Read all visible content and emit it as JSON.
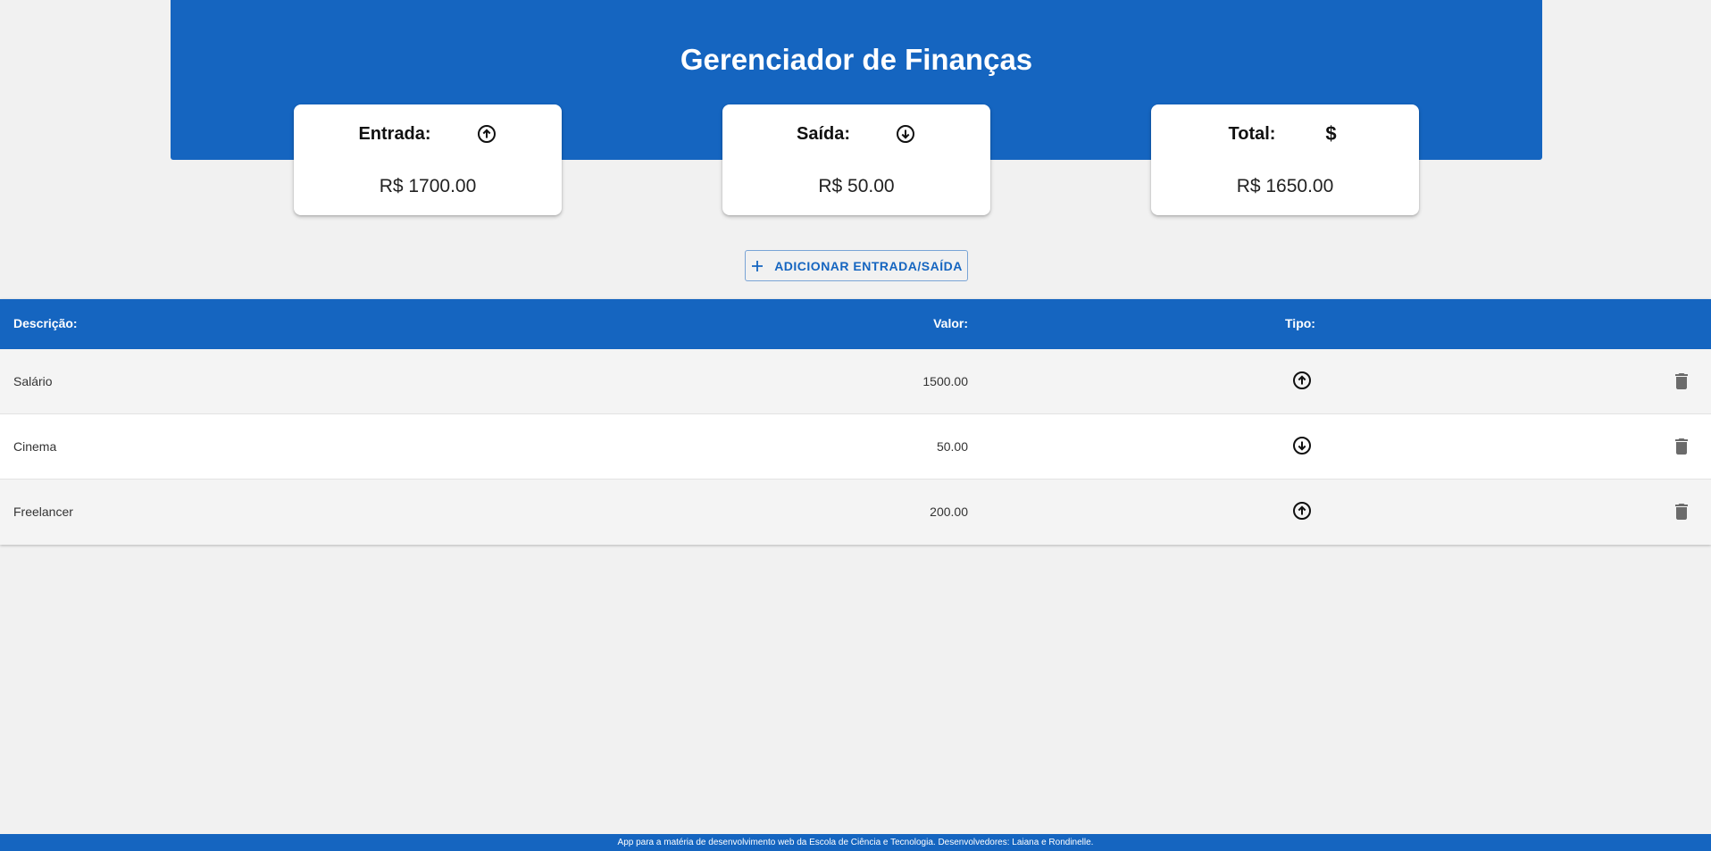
{
  "header": {
    "title": "Gerenciador de Finanças",
    "color": "#1565c0"
  },
  "cards": {
    "entrada": {
      "label": "Entrada:",
      "icon": "arrow-up-circle-icon",
      "value": "R$ 1700.00"
    },
    "saida": {
      "label": "Saída:",
      "icon": "arrow-down-circle-icon",
      "value": "R$ 50.00"
    },
    "total": {
      "label": "Total:",
      "icon": "dollar-icon",
      "symbol": "$",
      "value": "R$ 1650.00"
    }
  },
  "add_button": {
    "label": "ADICIONAR ENTRADA/SAÍDA",
    "icon": "plus-icon"
  },
  "table": {
    "headers": {
      "descricao": "Descrição:",
      "valor": "Valor:",
      "tipo": "Tipo:"
    },
    "rows": [
      {
        "descricao": "Salário",
        "valor": "1500.00",
        "tipo": "entrada"
      },
      {
        "descricao": "Cinema",
        "valor": "50.00",
        "tipo": "saida"
      },
      {
        "descricao": "Freelancer",
        "valor": "200.00",
        "tipo": "entrada"
      }
    ]
  },
  "footer": {
    "text": "App para a matéria de desenvolvimento web da Escola de Ciência e Tecnologia. Desenvolvedores: Laiana e Rondinelle."
  }
}
